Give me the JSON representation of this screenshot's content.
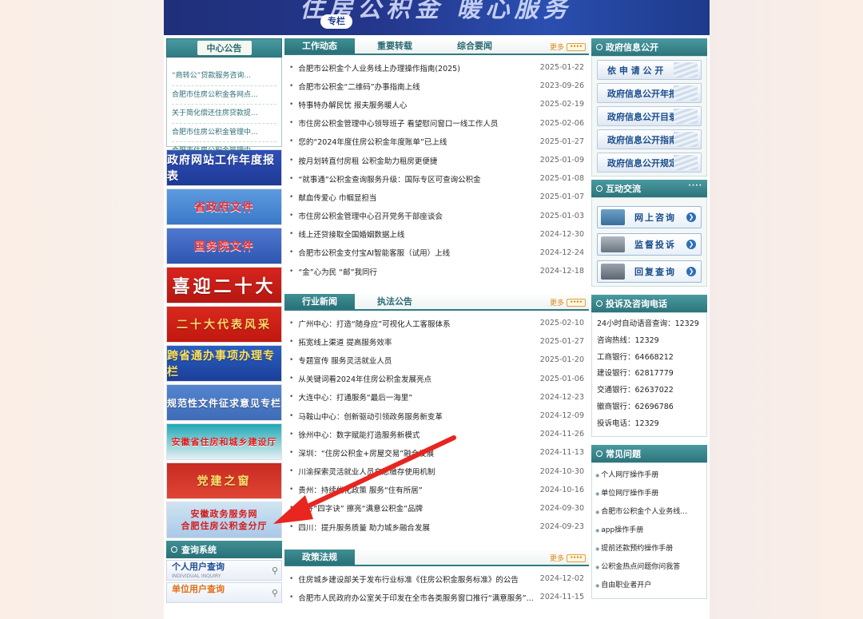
{
  "banner": {
    "title": "住房公积金 暖心服务",
    "tag": "专栏"
  },
  "left": {
    "notice_title": "中心公告",
    "notices": [
      "“商转公”贷款服务咨询...",
      "合肥市住房公积金各网点...",
      "关于简化偿还住房贷款提...",
      "合肥市住房公积金管理中...",
      "合肥市住房公积金管理中..."
    ],
    "banners": [
      "政府网站工作年度报表",
      "省政府文件",
      "国务院文件",
      "喜迎二十大",
      "二十大代表风采",
      "跨省通办事项办理专栏",
      "规范性文件征求意见专栏",
      "安徽省住房和城乡建设厅",
      "党建之窗"
    ],
    "service_banner": {
      "line1": "安徽政务服务网",
      "line2": "合肥住房公积金分厅"
    },
    "query_title": "查询系统",
    "query_items": [
      {
        "title": "个人用户查询",
        "sub": "INDIVIDUAL INQUIRY"
      },
      {
        "title": "单位用户查询",
        "sub": ""
      }
    ]
  },
  "middle": {
    "more": "更多",
    "sec1": {
      "tabs": [
        "工作动态",
        "重要转载",
        "综合要闻"
      ],
      "items": [
        {
          "t": "合肥市公积金个人业务线上办理操作指南(2025)",
          "d": "2025-01-22"
        },
        {
          "t": "合肥市公积金“二维码”办事指南上线",
          "d": "2023-09-26"
        },
        {
          "t": "特事特办解民忧 报夫服务暖人心",
          "d": "2025-02-19"
        },
        {
          "t": "市住房公积金管理中心领导班子 看望慰问窗口一线工作人员",
          "d": "2025-02-06"
        },
        {
          "t": "您的“2024年度住房公积金年度账单”已上线",
          "d": "2025-01-27"
        },
        {
          "t": "按月划转直付房租 公积金助力租房更便捷",
          "d": "2025-01-09"
        },
        {
          "t": "“就事通”公积金查询服务升级：国际专区可查询公积金",
          "d": "2025-01-08"
        },
        {
          "t": "献血传爱心 巾帼显担当",
          "d": "2025-01-07"
        },
        {
          "t": "市住房公积金管理中心召开党务干部座谈会",
          "d": "2025-01-03"
        },
        {
          "t": "线上还贷接取全国婚姻数据上线",
          "d": "2024-12-30"
        },
        {
          "t": "合肥市公积金支付宝AI智能客服（试用）上线",
          "d": "2024-12-24"
        },
        {
          "t": "“金”心为民 “邮”我同行",
          "d": "2024-12-18"
        }
      ]
    },
    "sec2": {
      "tabs": [
        "行业新闻",
        "执法公告"
      ],
      "items": [
        {
          "t": "广州中心：打造“随身应”可视化人工客服体系",
          "d": "2025-02-10"
        },
        {
          "t": "拓宽线上渠道 提高服务效率",
          "d": "2025-01-27"
        },
        {
          "t": "专题宣传 服务灵活就业人员",
          "d": "2025-01-20"
        },
        {
          "t": "从关键词看2024年住房公积金发展亮点",
          "d": "2025-01-06"
        },
        {
          "t": "大连中心：打通服务“最后一海里”",
          "d": "2024-12-23"
        },
        {
          "t": "马鞍山中心：创新驱动引领政务服务新变革",
          "d": "2024-12-09"
        },
        {
          "t": "徐州中心：数字赋能打造服务新模式",
          "d": "2024-11-26"
        },
        {
          "t": "深圳：“住房公积金+房屋交易”融合发展",
          "d": "2024-11-13"
        },
        {
          "t": "川渝探索灵活就业人员自愿缴存使用机制",
          "d": "2024-10-30"
        },
        {
          "t": "贵州：持续优化政策 服务“住有所居”",
          "d": "2024-10-16"
        },
        {
          "t": "念好“四字诀” 擦亮“满意公积金”品牌",
          "d": "2024-09-30"
        },
        {
          "t": "四川：提升服务质量 助力城乡融合发展",
          "d": "2024-09-23"
        }
      ]
    },
    "sec3": {
      "tabs": [
        "政策法规"
      ],
      "items": [
        {
          "t": "住房城乡建设部关于发布行业标准《住房公积金服务标准》的公告",
          "d": "2024-12-02"
        },
        {
          "t": "合肥市人民政府办公室关于印发在全市各类服务窗口推行“满意服务”...",
          "d": "2024-11-15"
        }
      ]
    }
  },
  "right": {
    "gov_title": "政府信息公开",
    "gov_items": [
      "依 申 请 公 开",
      "政府信息公开年报",
      "政府信息公开目录",
      "政府信息公开指南",
      "政府信息公开规定"
    ],
    "interact_title": "互动交流",
    "interact_dots": "····",
    "interact_items": [
      "网上咨询",
      "监督投诉",
      "回复查询"
    ],
    "phone_title": "投诉及咨询电话",
    "phones": [
      "24小时自动语音查询：12329",
      "咨询热线：12329",
      "工商银行：64668212",
      "建设银行：62817779",
      "交通银行：62637022",
      "徽商银行：62696786",
      "投诉电话：12329"
    ],
    "faq_title": "常见问题",
    "faqs": [
      "个人网厅操作手册",
      "单位网厅操作手册",
      "合肥市公积金个人业务线...",
      "app操作手册",
      "提前还款预约操作手册",
      "公积金热点问题你问我答",
      "自由职业者开户"
    ]
  },
  "colors": {
    "teal": "#2f7b83",
    "arrow": "#e8251f"
  }
}
